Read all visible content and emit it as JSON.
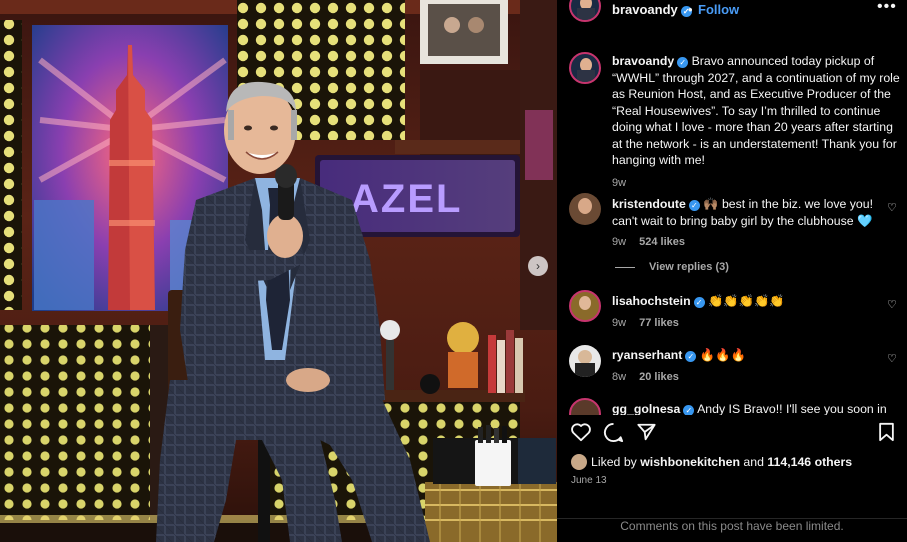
{
  "post": {
    "username": "bravoandy",
    "follow_label": "Follow",
    "more_label": "•••",
    "separator": "•"
  },
  "caption": {
    "username": "bravoandy",
    "text": "Bravo announced today pickup of “WWHL” through 2027, and a continuation of my role as Reunion Host, and as Executive Producer of the “Real Housewives”. To say I’m thrilled to continue doing what I love - more than 20 years after starting at the network - is an understatement! Thank you for hanging with me!",
    "age": "9w"
  },
  "comments": [
    {
      "username": "kristendoute",
      "text": "🙌🏽 best in the biz. we love you! can't wait to bring baby girl by the clubhouse 🩵",
      "age": "9w",
      "likes": "524 likes",
      "replies": "View replies (3)"
    },
    {
      "username": "lisahochstein",
      "text": "👏👏👏👏👏",
      "age": "9w",
      "likes": "77 likes"
    },
    {
      "username": "ryanserhant",
      "text": "🔥🔥🔥",
      "age": "8w",
      "likes": "20 likes"
    },
    {
      "username": "gg_golnesa",
      "text": "Andy IS Bravo!! I'll see you soon in"
    }
  ],
  "footer": {
    "liked_prefix": "Liked by",
    "liked_user": "wishbonekitchen",
    "liked_and": "and",
    "liked_count": "114,146 others",
    "date": "June 13",
    "limited_notice": "Comments on this post have been limited."
  },
  "photo": {
    "sign_text": "AZEL",
    "carousel_next_icon": "chevron-right-icon"
  },
  "colors": {
    "accent_blue": "#4a9cf6",
    "verified_blue": "#3897f0",
    "meta_gray": "#a8a8a8",
    "background": "#000000"
  }
}
